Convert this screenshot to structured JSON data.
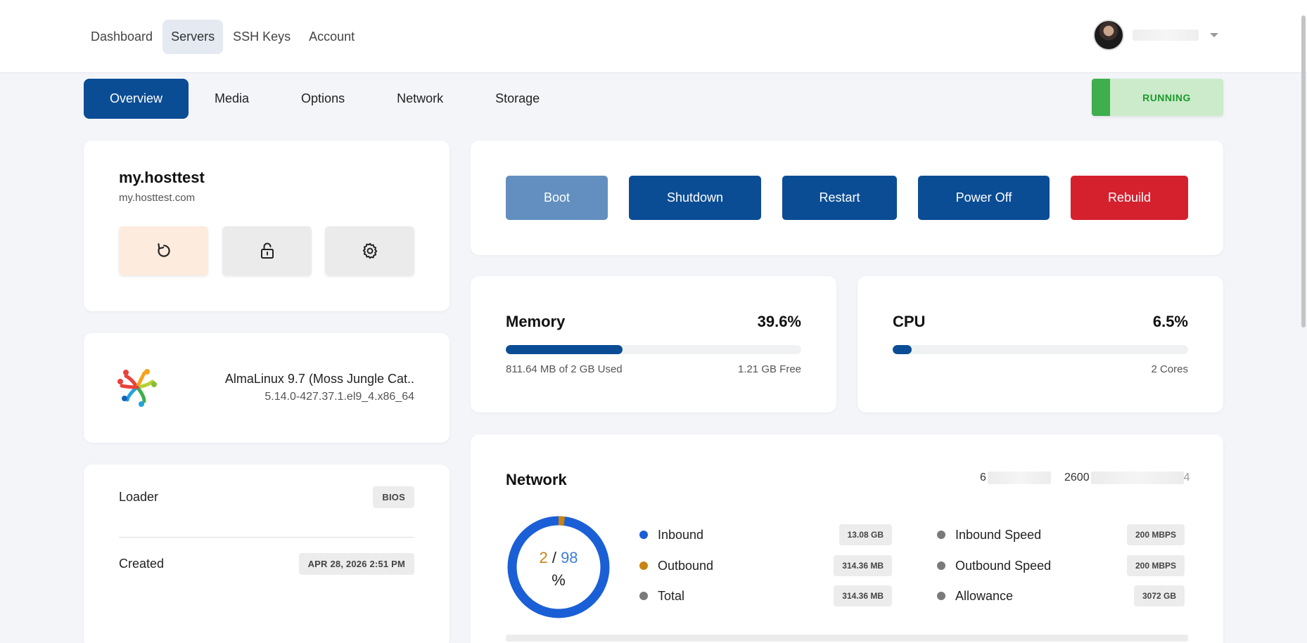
{
  "nav": {
    "items": [
      "Dashboard",
      "Servers",
      "SSH Keys",
      "Account"
    ],
    "active": "Servers"
  },
  "tabs": [
    "Overview",
    "Media",
    "Options",
    "Network",
    "Storage"
  ],
  "status": "RUNNING",
  "server": {
    "name": "my.hosttest",
    "hostname": "my.hosttest.com"
  },
  "os": {
    "name": "AlmaLinux 9.7 (Moss Jungle Cat..",
    "kernel": "5.14.0-427.37.1.el9_4.x86_64"
  },
  "info": {
    "loader_label": "Loader",
    "loader_value": "BIOS",
    "created_label": "Created",
    "created_value": "APR 28, 2026 2:51 PM"
  },
  "actions": {
    "boot": "Boot",
    "shutdown": "Shutdown",
    "restart": "Restart",
    "power_off": "Power Off",
    "rebuild": "Rebuild"
  },
  "memory": {
    "title": "Memory",
    "percent": "39.6%",
    "fill": 0.396,
    "used": "811.64 MB of 2 GB Used",
    "free": "1.21 GB Free"
  },
  "cpu": {
    "title": "CPU",
    "percent": "6.5%",
    "fill": 0.065,
    "cores": "2 Cores"
  },
  "network": {
    "title": "Network",
    "ipv4_prefix": "6",
    "ipv6_prefix": "2600",
    "ipv6_suffix": "4",
    "donut_outbound": "2",
    "donut_separator": "/",
    "donut_inbound": "98",
    "donut_unit": "%",
    "outbound_share": 0.02,
    "inbound_label": "Inbound",
    "inbound_value": "13.08 GB",
    "outbound_label": "Outbound",
    "outbound_value": "314.36 MB",
    "total_label": "Total",
    "total_value": "314.36 MB",
    "inbound_speed_label": "Inbound Speed",
    "inbound_speed_value": "200 MBPS",
    "outbound_speed_label": "Outbound Speed",
    "outbound_speed_value": "200 MBPS",
    "allowance_label": "Allowance",
    "allowance_value": "3072 GB"
  },
  "colors": {
    "primary": "#0b4d95",
    "danger": "#d5202e",
    "running": "#3fae4c",
    "inbound": "#1a5fd6",
    "outbound": "#c98312",
    "neutral": "#7a7a7a"
  },
  "icons": {
    "restart": "restart-icon",
    "lock": "lock-icon",
    "settings": "gear-icon",
    "os_logo": "almalinux-logo"
  }
}
